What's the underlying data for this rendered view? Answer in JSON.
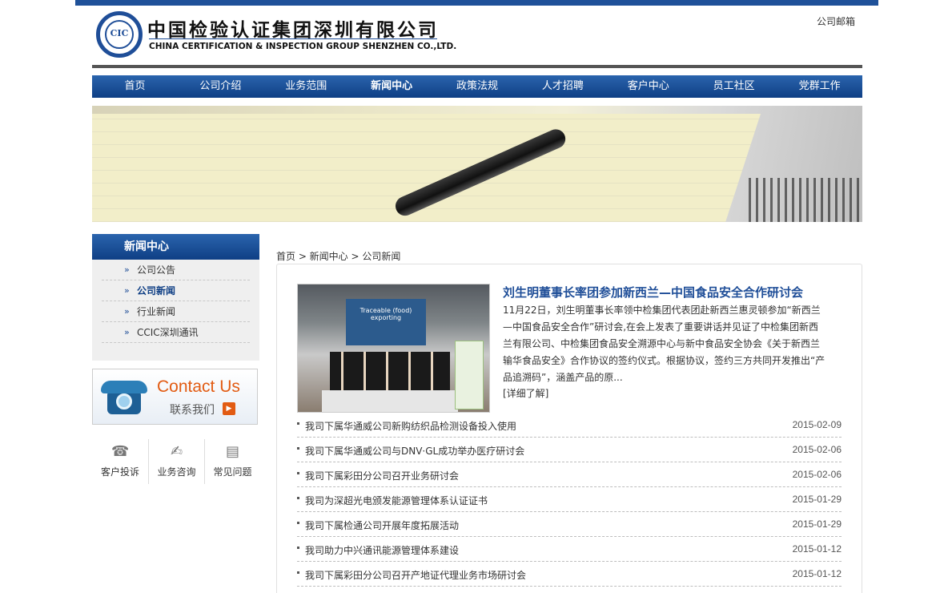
{
  "header": {
    "logo_mark": "CIC",
    "logo_cn": "中国检验认证集团深圳有限公司",
    "logo_en": "CHINA CERTIFICATION & INSPECTION GROUP SHENZHEN CO.,LTD.",
    "mailbox_link": "公司邮箱"
  },
  "nav": {
    "items": [
      {
        "label": "首页"
      },
      {
        "label": "公司介绍"
      },
      {
        "label": "业务范围"
      },
      {
        "label": "新闻中心"
      },
      {
        "label": "政策法规"
      },
      {
        "label": "人才招聘"
      },
      {
        "label": "客户中心"
      },
      {
        "label": "员工社区"
      },
      {
        "label": "党群工作"
      }
    ],
    "active_index": 3
  },
  "sidebar": {
    "title": "新闻中心",
    "items": [
      {
        "label": "公司公告"
      },
      {
        "label": "公司新闻"
      },
      {
        "label": "行业新闻"
      },
      {
        "label": "CCIC深圳通讯"
      }
    ],
    "active_index": 1,
    "contact": {
      "en": "Contact Us",
      "cn": "联系我们"
    },
    "quick_links": [
      {
        "label": "客户投诉",
        "icon": "phone-icon"
      },
      {
        "label": "业务咨询",
        "icon": "consult-icon"
      },
      {
        "label": "常见问题",
        "icon": "clipboard-icon"
      }
    ]
  },
  "breadcrumb": "首页 > 新闻中心 > 公司新闻",
  "featured": {
    "title": "刘生明董事长率团参加新西兰—中国食品安全合作研讨会",
    "summary": "11月22日，刘生明董事长率领中检集团代表团赴新西兰惠灵顿参加“新西兰—中国食品安全合作”研讨会,在会上发表了重要讲话并见证了中检集团新西兰有限公司、中检集团食品安全溯源中心与新中食品安全协会《关于新西兰输华食品安全》合作协议的签约仪式。根据协议，签约三方共同开发推出“产品追溯码”，涵盖产品的原...",
    "more": "[详细了解]",
    "image_screen_text": "Traceable (food) exporting"
  },
  "news": [
    {
      "title": "我司下属华通威公司新购纺织品检测设备投入使用",
      "date": "2015-02-09"
    },
    {
      "title": "我司下属华通威公司与DNV·GL成功举办医疗研讨会",
      "date": "2015-02-06"
    },
    {
      "title": "我司下属彩田分公司召开业务研讨会",
      "date": "2015-02-06"
    },
    {
      "title": "我司为深超光电颁发能源管理体系认证证书",
      "date": "2015-01-29"
    },
    {
      "title": "我司下属检通公司开展年度拓展活动",
      "date": "2015-01-29"
    },
    {
      "title": "我司助力中兴通讯能源管理体系建设",
      "date": "2015-01-12"
    },
    {
      "title": "我司下属彩田分公司召开产地证代理业务市场研讨会",
      "date": "2015-01-12"
    }
  ],
  "colors": {
    "brand_blue": "#1f5199",
    "contact_orange": "#e25b12"
  }
}
